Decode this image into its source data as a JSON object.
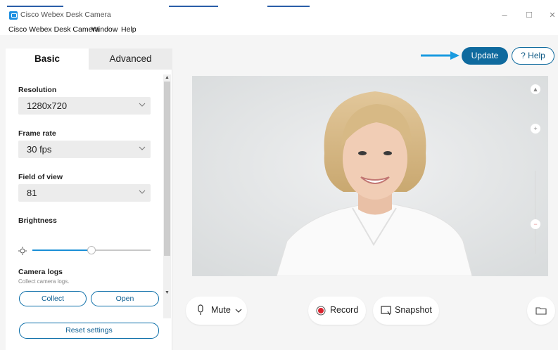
{
  "window": {
    "title": "Cisco Webex Desk Camera",
    "controls": {
      "minimize": "–",
      "maximize": "☐",
      "close": "✕"
    }
  },
  "menubar": [
    "Cisco Webex Desk Camera",
    "Window",
    "Help"
  ],
  "tabs": [
    {
      "label": "Basic",
      "active": true
    },
    {
      "label": "Advanced",
      "active": false
    }
  ],
  "settings": {
    "resolution": {
      "label": "Resolution",
      "value": "1280x720"
    },
    "frame_rate": {
      "label": "Frame rate",
      "value": "30 fps"
    },
    "field_of_view": {
      "label": "Field of view",
      "value": "81"
    },
    "brightness": {
      "label": "Brightness",
      "level": 0.5
    }
  },
  "camera_logs": {
    "title": "Camera logs",
    "description": "Collect camera logs.",
    "collect_label": "Collect",
    "open_label": "Open"
  },
  "reset_label": "Reset settings",
  "header": {
    "update_label": "Update",
    "help_label": "? Help"
  },
  "controls": {
    "mute_label": "Mute",
    "record_label": "Record",
    "snapshot_label": "Snapshot"
  },
  "colors": {
    "accent": "#0f6a9e",
    "arrow": "#1a9be0",
    "record": "#d9232e"
  }
}
